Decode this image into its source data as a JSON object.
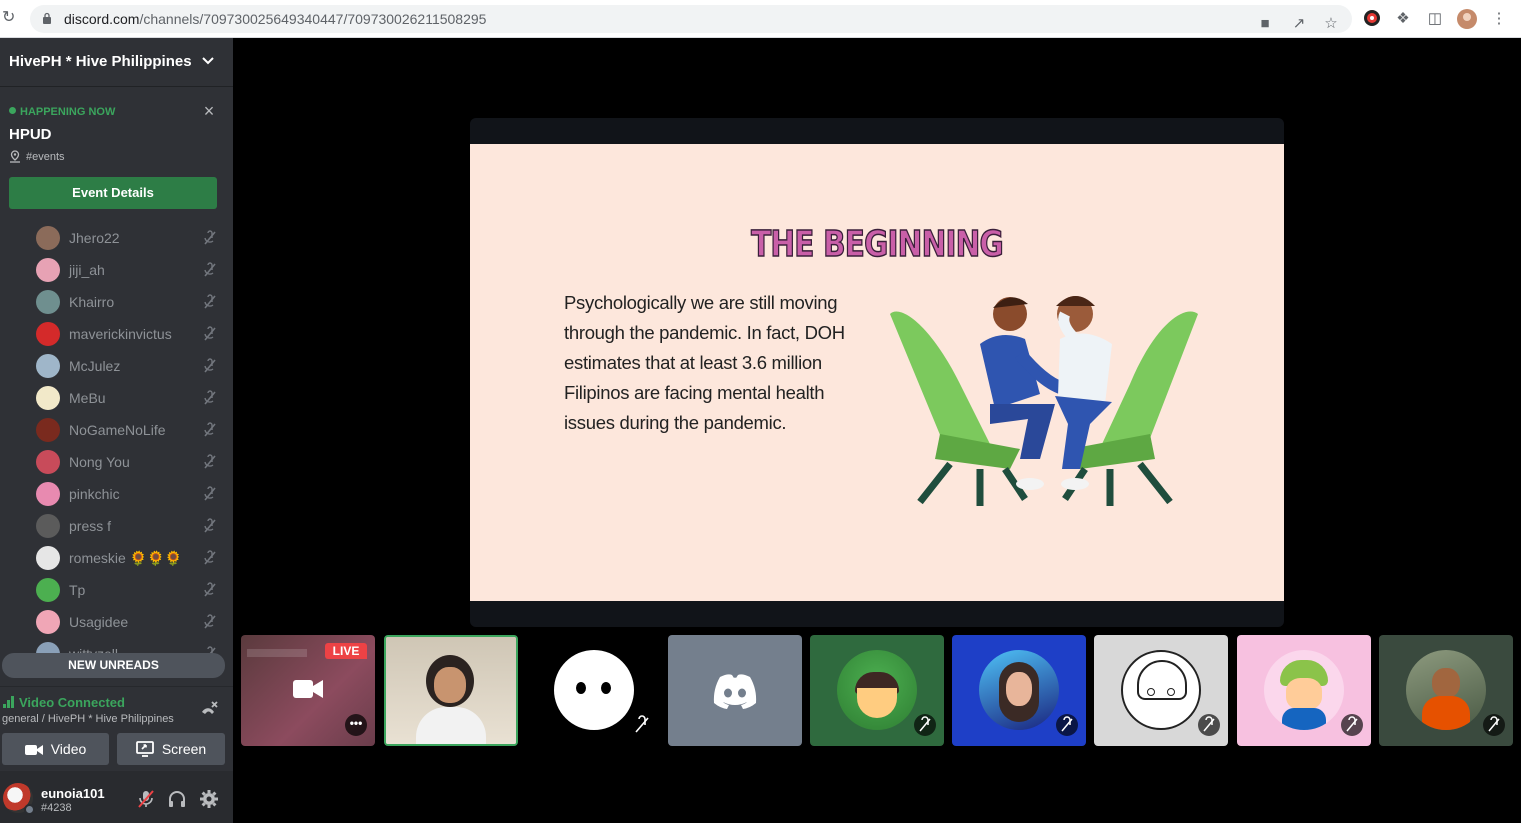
{
  "browser": {
    "url_host": "discord.com",
    "url_path": "/channels/709730025649340447/709730026211508295"
  },
  "server": {
    "name": "HivePH * Hive Philippines"
  },
  "event": {
    "status": "HAPPENING NOW",
    "title": "HPUD",
    "location": "#events",
    "details_button": "Event Details"
  },
  "members": [
    {
      "name": "Jhero22",
      "color": "#8b6b5a"
    },
    {
      "name": "jiji_ah",
      "color": "#e7a2b4"
    },
    {
      "name": "Khairro",
      "color": "#6f8f8f"
    },
    {
      "name": "maverickinvictus",
      "color": "#d42a2a"
    },
    {
      "name": "McJulez",
      "color": "#9fb6c9"
    },
    {
      "name": "MeBu",
      "color": "#f2e9c9"
    },
    {
      "name": "NoGameNoLife",
      "color": "#7a2a1e"
    },
    {
      "name": "Nong You",
      "color": "#c84b5a"
    },
    {
      "name": "pinkchic",
      "color": "#e88ab0"
    },
    {
      "name": "press f",
      "color": "#5b5b5b"
    },
    {
      "name": "romeskie 🌻🌻🌻",
      "color": "#e6e6e6"
    },
    {
      "name": "Tp",
      "color": "#4caf50"
    },
    {
      "name": "Usagidee",
      "color": "#f0a6b6"
    },
    {
      "name": "wittyzell",
      "color": "#8aa0b8"
    }
  ],
  "new_unreads": "NEW UNREADS",
  "voice": {
    "status": "Video Connected",
    "channel": "general / HivePH * Hive Philippines",
    "video_button": "Video",
    "screen_button": "Screen"
  },
  "user": {
    "name": "eunoia101",
    "tag": "#4238"
  },
  "slide": {
    "title": "THE BEGINNING",
    "body": "Psychologically we are still moving through the pandemic. In fact, DOH estimates that at least 3.6 million Filipinos are facing mental health issues during the pandemic."
  },
  "tiles": {
    "live_label": "LIVE",
    "more_label": "•••"
  },
  "colors": {
    "discord_green": "#3ba55d",
    "event_button": "#2d7d46",
    "live_red": "#ed4245",
    "sidebar_bg": "#2f3136"
  }
}
